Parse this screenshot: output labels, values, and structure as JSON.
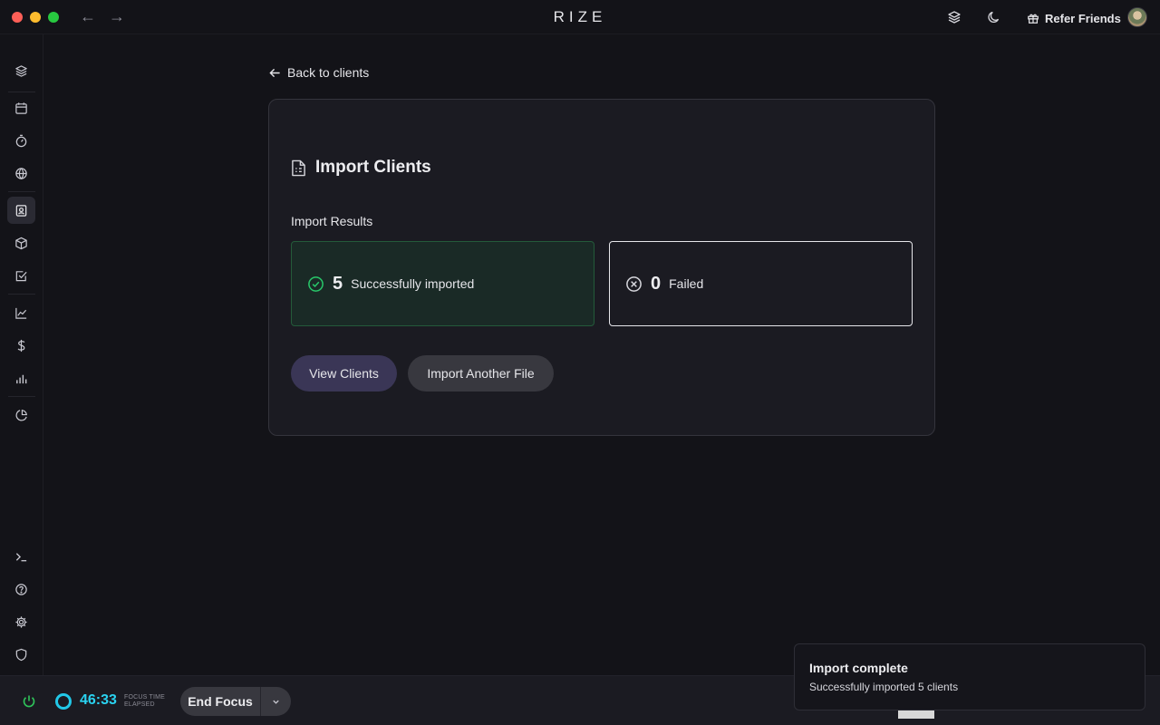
{
  "app": {
    "title": "RIZE"
  },
  "titlebar": {
    "refer_label": "Refer Friends"
  },
  "main": {
    "back_label": "Back to clients",
    "card_title": "Import Clients",
    "results_label": "Import Results",
    "success": {
      "count": "5",
      "label": "Successfully imported"
    },
    "failed": {
      "count": "0",
      "label": "Failed"
    },
    "view_clients_label": "View Clients",
    "import_another_label": "Import Another File"
  },
  "bottombar": {
    "timer": "46:33",
    "focus_label_line1": "FOCUS TIME",
    "focus_label_line2": "ELAPSED",
    "end_focus_label": "End Focus"
  },
  "toast": {
    "title": "Import complete",
    "description": "Successfully imported 5 clients"
  },
  "colors": {
    "accent_cyan": "#2ad2f0",
    "success_green": "#28c86a",
    "primary_button": "#3a3656"
  }
}
